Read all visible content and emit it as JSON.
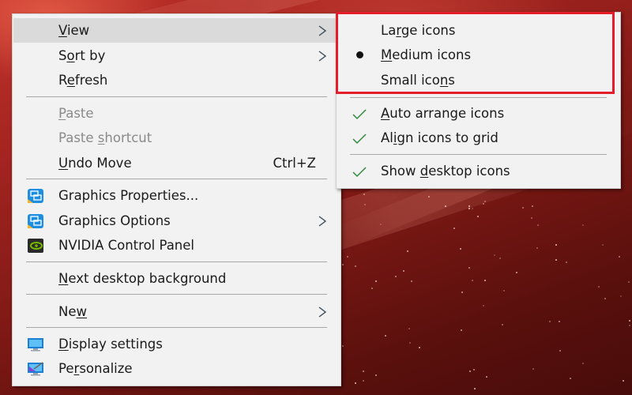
{
  "desktop": {
    "wallpaper": "red-starfield",
    "colors": {
      "wallpaper_base": "#7c1814",
      "highlight_box": "#e51d2b",
      "menu_bg": "#f2f2f2",
      "hover_bg": "#dadada",
      "check_color": "#2e8b3e"
    }
  },
  "context_menu": {
    "items": [
      {
        "label_pre": "",
        "label_ul": "V",
        "label_post": "iew",
        "has_submenu": true,
        "highlighted": true
      },
      {
        "label_pre": "S",
        "label_ul": "o",
        "label_post": "rt by",
        "has_submenu": true
      },
      {
        "label_pre": "R",
        "label_ul": "e",
        "label_post": "fresh"
      },
      {
        "label_pre": "",
        "label_ul": "P",
        "label_post": "aste",
        "disabled": true
      },
      {
        "label_pre": "Paste ",
        "label_ul": "s",
        "label_post": "hortcut",
        "disabled": true
      },
      {
        "label_pre": "",
        "label_ul": "U",
        "label_post": "ndo Move",
        "shortcut": "Ctrl+Z"
      },
      {
        "label_pre": "Graphics Properties...",
        "label_ul": "",
        "label_post": "",
        "icon": "intel-graphics-icon"
      },
      {
        "label_pre": "Graphics Options",
        "label_ul": "",
        "label_post": "",
        "icon": "intel-graphics-icon",
        "has_submenu": true
      },
      {
        "label_pre": "NVIDIA Control Panel",
        "label_ul": "",
        "label_post": "",
        "icon": "nvidia-icon"
      },
      {
        "label_pre": "",
        "label_ul": "N",
        "label_post": "ext desktop background"
      },
      {
        "label_pre": "Ne",
        "label_ul": "w",
        "label_post": "",
        "has_submenu": true
      },
      {
        "label_pre": "",
        "label_ul": "D",
        "label_post": "isplay settings",
        "icon": "display-settings-icon"
      },
      {
        "label_pre": "Pe",
        "label_ul": "r",
        "label_post": "sonalize",
        "icon": "personalize-icon"
      }
    ]
  },
  "view_submenu": {
    "items": [
      {
        "label_pre": "La",
        "label_ul": "r",
        "label_post": "ge icons",
        "mark": "none"
      },
      {
        "label_pre": "",
        "label_ul": "M",
        "label_post": "edium icons",
        "mark": "bullet",
        "selected": true
      },
      {
        "label_pre": "Small ico",
        "label_ul": "n",
        "label_post": "s",
        "mark": "none"
      },
      {
        "label_pre": "",
        "label_ul": "A",
        "label_post": "uto arrange icons",
        "mark": "check",
        "checked": true
      },
      {
        "label_pre": "Al",
        "label_ul": "i",
        "label_post": "gn icons to grid",
        "mark": "check",
        "checked": true
      },
      {
        "label_pre": "Show ",
        "label_ul": "d",
        "label_post": "esktop icons",
        "mark": "check",
        "checked": true
      }
    ]
  }
}
